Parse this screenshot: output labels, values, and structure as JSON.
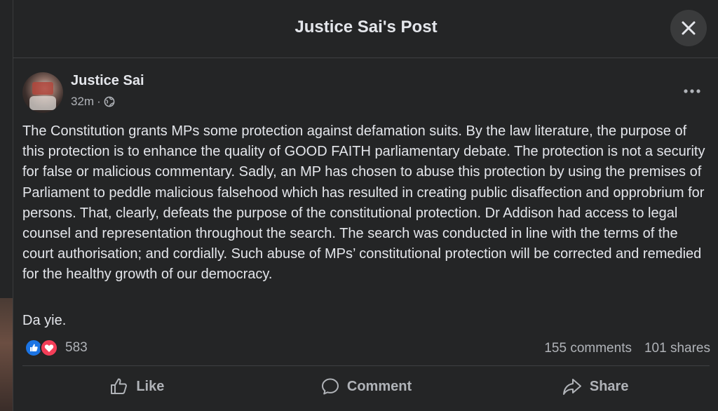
{
  "modal": {
    "title": "Justice Sai's Post",
    "close_icon": "close-icon"
  },
  "post": {
    "author": "Justice Sai",
    "time": "32m",
    "separator": "·",
    "privacy_icon": "globe-icon",
    "more_icon": "more-options-icon",
    "body": "The Constitution grants MPs some protection against defamation suits. By the law literature, the purpose of this protection is to enhance the quality of GOOD FAITH parliamentary debate. The protection is not a security for false or malicious commentary. Sadly, an MP has chosen to abuse this protection by using the premises of Parliament to peddle malicious falsehood which has resulted in creating public disaffection and opprobrium for persons. That, clearly, defeats the purpose of the constitutional protection. Dr Addison had access to legal counsel and representation throughout the search. The search was conducted in line with the terms of the court authorisation; and cordially. Such abuse of MPs’ constitutional protection will be corrected and remedied for the healthy growth of our democracy.",
    "signoff": "Da yie."
  },
  "engagement": {
    "reaction_count": "583",
    "comments": "155 comments",
    "shares": "101 shares"
  },
  "actions": {
    "like": "Like",
    "comment": "Comment",
    "share": "Share"
  },
  "colors": {
    "background": "#18191a",
    "card": "#242526",
    "text_primary": "#e4e6eb",
    "text_secondary": "#b0b3b8",
    "like_blue": "#1b74e4",
    "love_red": "#f33e58"
  }
}
